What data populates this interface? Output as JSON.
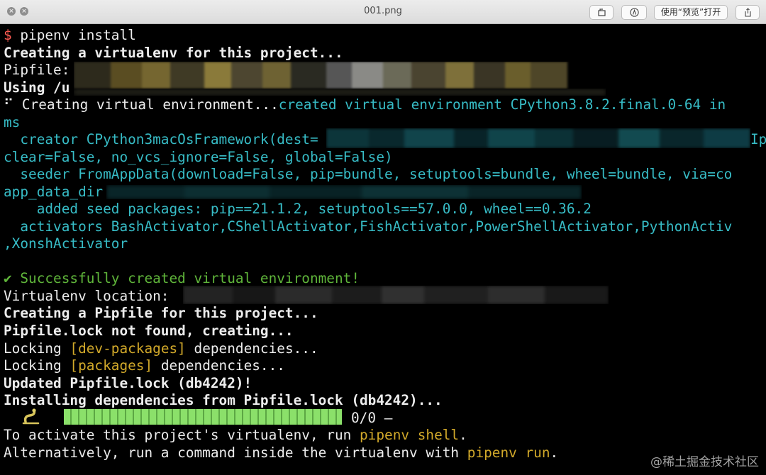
{
  "window": {
    "title": "001.png",
    "open_with_label": "使用“预览”打开"
  },
  "terminal": {
    "lines": [
      {
        "prompt": "$",
        "text": " pipenv install"
      },
      {
        "text": "Creating a virtualenv for this project..."
      },
      {
        "text": "Pipfile:"
      },
      {
        "text": "Using /u"
      },
      {
        "a": "⠋ Creating virtual environment...",
        "b": "created virtual environment CPython3.8.2.final.0-64 in"
      },
      {
        "text": "ms"
      },
      {
        "text": "  creator CPython3macOsFramework(dest=",
        "tail": "Ip"
      },
      {
        "text": "clear=False, no_vcs_ignore=False, global=False)"
      },
      {
        "text": "  seeder FromAppData(download=False, pip=bundle, setuptools=bundle, wheel=bundle, via=co"
      },
      {
        "text": "app_data_dir"
      },
      {
        "text": "    added seed packages: pip==21.1.2, setuptools==57.0.0, wheel==0.36.2"
      },
      {
        "text": "  activators BashActivator,CShellActivator,FishActivator,PowerShellActivator,PythonActiv"
      },
      {
        "text": ",XonshActivator"
      },
      {
        "text": ""
      },
      {
        "text": "✔ Successfully created virtual environment!"
      },
      {
        "text": "Virtualenv location:"
      },
      {
        "text": "Creating a Pipfile for this project..."
      },
      {
        "text": "Pipfile.lock not found, creating..."
      },
      {
        "a": "Locking ",
        "b": "[dev-packages]",
        "c": " dependencies..."
      },
      {
        "a": "Locking ",
        "b": "[packages]",
        "c": " dependencies..."
      },
      {
        "text": "Updated Pipfile.lock (db4242)!"
      },
      {
        "text": "Installing dependencies from Pipfile.lock (db4242)..."
      },
      {
        "text": "0/0 —"
      },
      {
        "a": "To activate this project's virtualenv, run ",
        "b": "pipenv shell",
        "c": "."
      },
      {
        "a": "Alternatively, run a command inside the virtualenv with ",
        "b": "pipenv run",
        "c": "."
      }
    ],
    "progress": {
      "fraction": 1.0
    }
  },
  "watermark": "@稀土掘金技术社区",
  "colors": {
    "prompt": "#ff5b52",
    "cyan": "#37bcc6",
    "highlight": "#d2a92a",
    "success": "#5fb53a",
    "progress": "#8be06a"
  }
}
